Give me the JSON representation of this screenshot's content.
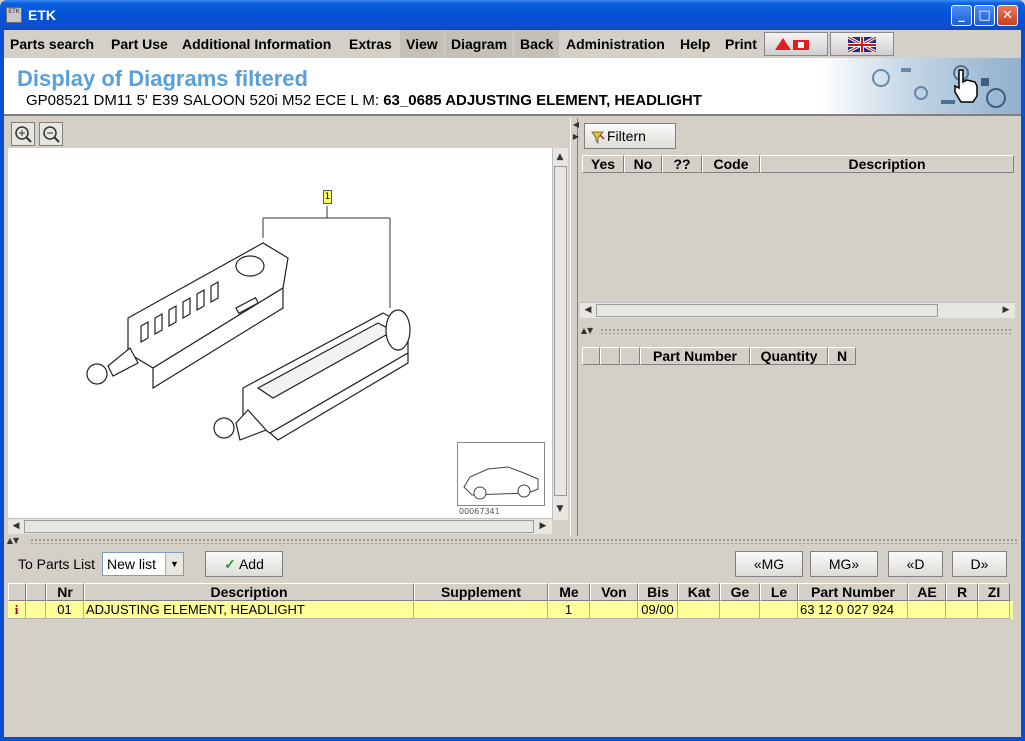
{
  "window": {
    "title": "ETK",
    "app_icon_text": "ETK"
  },
  "menu": {
    "items": [
      "Parts search",
      "Part Use",
      "Additional Information",
      "Extras",
      "View",
      "Diagram",
      "Back",
      "Administration",
      "Help",
      "Print"
    ]
  },
  "header": {
    "title": "Display of Diagrams filtered",
    "subtitle_prefix": "GP08521 DM11 5' E39 SALOON 520i M52 ECE L M:",
    "subtitle_bold": "63_0685 ADJUSTING ELEMENT, HEADLIGHT"
  },
  "diagram": {
    "callout": "1",
    "thumbnail_id": "00067341"
  },
  "filter": {
    "button_label": "Filtern",
    "columns": [
      "Yes",
      "No",
      "??",
      "Code",
      "Description"
    ]
  },
  "parts_table": {
    "columns": [
      "",
      "",
      "",
      "Part Number",
      "Quantity",
      "N"
    ]
  },
  "bottom": {
    "to_parts_list_label": "To Parts List",
    "list_select_value": "New list",
    "add_label": "Add",
    "nav_buttons": [
      "«MG",
      "MG»",
      "«D",
      "D»"
    ]
  },
  "grid": {
    "columns": [
      "",
      "",
      "Nr",
      "Description",
      "Supplement",
      "Me",
      "Von",
      "Bis",
      "Kat",
      "Ge",
      "Le",
      "Part Number",
      "AE",
      "R",
      "ZI"
    ],
    "rows": [
      {
        "info": "i",
        "blank": "",
        "nr": "01",
        "description": "ADJUSTING ELEMENT, HEADLIGHT",
        "supplement": "",
        "me": "1",
        "von": "",
        "bis": "09/00",
        "kat": "",
        "ge": "",
        "le": "",
        "part_number": "63 12 0 027 924",
        "ae": "",
        "r": "",
        "zi": ""
      }
    ]
  },
  "colors": {
    "title_blue": "#5aa0d8",
    "row_highlight": "#ffff99",
    "titlebar": "#0554d8"
  }
}
